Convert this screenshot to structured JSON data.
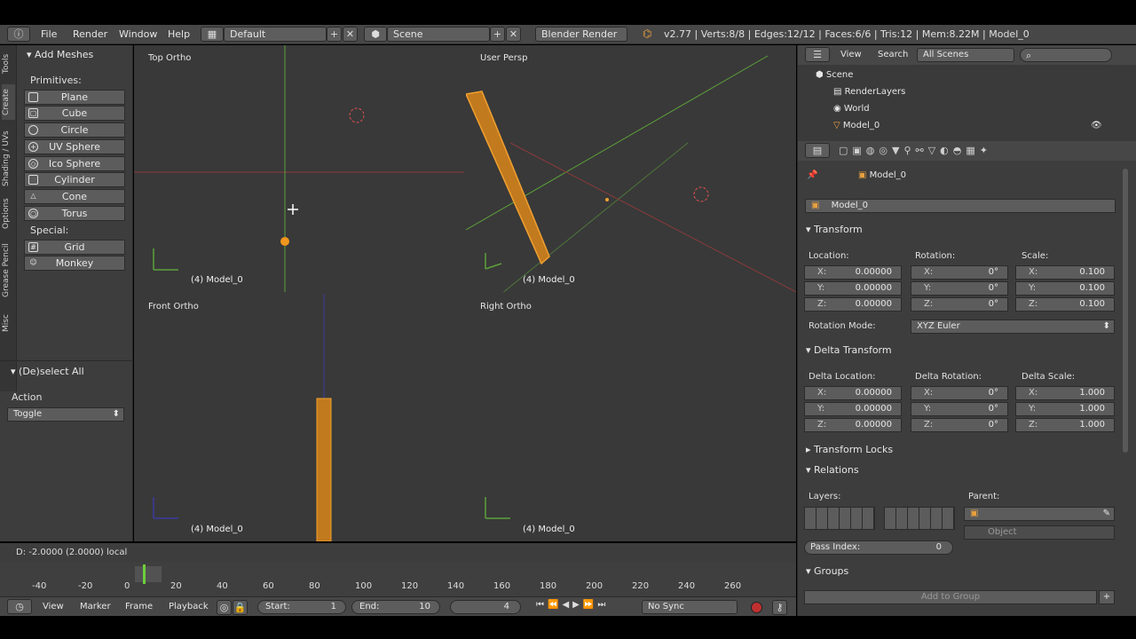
{
  "topbar": {
    "menus": [
      "File",
      "Render",
      "Window",
      "Help"
    ],
    "layout": "Default",
    "scene": "Scene",
    "engine": "Blender Render",
    "stats": "v2.77 | Verts:8/8 | Edges:12/12 | Faces:6/6 | Tris:12 | Mem:8.22M | Model_0"
  },
  "toolshelf": {
    "tabs": [
      "Tools",
      "Create",
      "Shading / UVs",
      "Options",
      "Grease Pencil",
      "Misc"
    ],
    "add_meshes_title": "Add Meshes",
    "primitives_label": "Primitives:",
    "primitives": [
      "Plane",
      "Cube",
      "Circle",
      "UV Sphere",
      "Ico Sphere",
      "Cylinder",
      "Cone",
      "Torus"
    ],
    "special_label": "Special:",
    "special": [
      "Grid",
      "Monkey"
    ],
    "operator_title": "(De)select All",
    "action_label": "Action",
    "action_value": "Toggle"
  },
  "viewports": {
    "top": {
      "title": "Top Ortho",
      "name": "(4) Model_0"
    },
    "persp": {
      "title": "User Persp",
      "name": "(4) Model_0"
    },
    "front": {
      "title": "Front Ortho",
      "name": "(4) Model_0"
    },
    "right": {
      "title": "Right Ortho",
      "name": "(4) Model_0"
    }
  },
  "status": "D: -2.0000 (2.0000) local",
  "timeline": {
    "ticks": [
      "-40",
      "-20",
      "0",
      "20",
      "40",
      "60",
      "80",
      "100",
      "120",
      "140",
      "160",
      "180",
      "200",
      "220",
      "240",
      "260"
    ],
    "menus": [
      "View",
      "Marker",
      "Frame",
      "Playback"
    ],
    "start_label": "Start:",
    "start": "1",
    "end_label": "End:",
    "end": "10",
    "current": "4",
    "sync": "No Sync"
  },
  "outliner": {
    "menus": [
      "View",
      "Search"
    ],
    "filter": "All Scenes",
    "items": [
      "Scene",
      "RenderLayers",
      "World",
      "Model_0"
    ]
  },
  "properties": {
    "object_breadcrumb": "Model_0",
    "object_name": "Model_0",
    "transform_title": "Transform",
    "location_label": "Location:",
    "rotation_label": "Rotation:",
    "scale_label": "Scale:",
    "location": [
      "0.00000",
      "0.00000",
      "0.00000"
    ],
    "rotation": [
      "0°",
      "0°",
      "0°"
    ],
    "scale": [
      "0.100",
      "0.100",
      "0.100"
    ],
    "rotation_mode_label": "Rotation Mode:",
    "rotation_mode": "XYZ Euler",
    "delta_title": "Delta Transform",
    "delta_location_label": "Delta Location:",
    "delta_rotation_label": "Delta Rotation:",
    "delta_scale_label": "Delta Scale:",
    "delta_location": [
      "0.00000",
      "0.00000",
      "0.00000"
    ],
    "delta_rotation": [
      "0°",
      "0°",
      "0°"
    ],
    "delta_scale": [
      "1.000",
      "1.000",
      "1.000"
    ],
    "transform_locks_title": "Transform Locks",
    "relations_title": "Relations",
    "layers_label": "Layers:",
    "parent_label": "Parent:",
    "parent_type": "Object",
    "pass_index_label": "Pass Index:",
    "pass_index": "0",
    "groups_title": "Groups",
    "add_to_group": "Add to Group",
    "axes": [
      "X:",
      "Y:",
      "Z:"
    ]
  }
}
